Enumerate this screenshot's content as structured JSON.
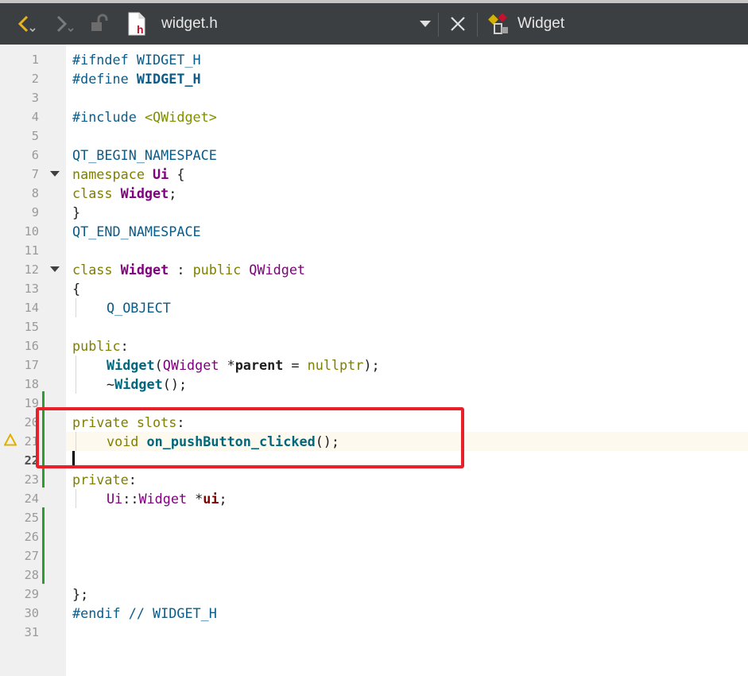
{
  "toolbar": {
    "filename": "widget.h",
    "classname": "Widget",
    "icons": [
      "back-arrow-icon",
      "forward-arrow-icon",
      "lock-icon",
      "header-file-icon",
      "dropdown-arrow-icon",
      "close-icon",
      "class-icon"
    ]
  },
  "colors": {
    "toolbar_bg": "#3c3f41",
    "gutter_bg": "#f0f0f0",
    "highlight_box": "#e8202a",
    "change_marker": "#2e9d2e",
    "warning": "#e0b000"
  },
  "lines": {
    "l1": "1",
    "l2": "2",
    "l3": "3",
    "l4": "4",
    "l5": "5",
    "l6": "6",
    "l7": "7",
    "l8": "8",
    "l9": "9",
    "l10": "10",
    "l11": "11",
    "l12": "12",
    "l13": "13",
    "l14": "14",
    "l15": "15",
    "l16": "16",
    "l17": "17",
    "l18": "18",
    "l19": "19",
    "l20": "20",
    "l21": "21",
    "l22": "22",
    "l23": "23",
    "l24": "24",
    "l25": "25",
    "l26": "26",
    "l27": "27",
    "l28": "28",
    "l29": "29",
    "l30": "30",
    "l31": "31"
  },
  "code": {
    "c1_a": "#ifndef ",
    "c1_b": "WIDGET_H",
    "c2_a": "#define ",
    "c2_b": "WIDGET_H",
    "c4_a": "#include ",
    "c4_b": "<QWidget>",
    "c6": "QT_BEGIN_NAMESPACE",
    "c7_a": "namespace ",
    "c7_b": "Ui",
    "c7_c": " {",
    "c8_a": "class ",
    "c8_b": "Widget",
    "c8_c": ";",
    "c9": "}",
    "c10": "QT_END_NAMESPACE",
    "c12_a": "class ",
    "c12_b": "Widget",
    "c12_c": " : ",
    "c12_d": "public ",
    "c12_e": "QWidget",
    "c13": "{",
    "c14": "Q_OBJECT",
    "c16_a": "public",
    "c16_b": ":",
    "c17_a": "Widget",
    "c17_b": "(",
    "c17_c": "QWidget",
    "c17_d": " *",
    "c17_e": "parent",
    "c17_f": " = ",
    "c17_g": "nullptr",
    "c17_h": ");",
    "c18_a": "~",
    "c18_b": "Widget",
    "c18_c": "();",
    "c20_a": "private slots",
    "c20_b": ":",
    "c21_a": "void ",
    "c21_b": "on_pushButton_clicked",
    "c21_c": "();",
    "c23_a": "private",
    "c23_b": ":",
    "c24_a": "Ui",
    "c24_b": "::",
    "c24_c": "Widget",
    "c24_d": " *",
    "c24_e": "ui",
    "c24_f": ";",
    "c29": "};",
    "c30_a": "#endif ",
    "c30_b": "// WIDGET_H"
  }
}
